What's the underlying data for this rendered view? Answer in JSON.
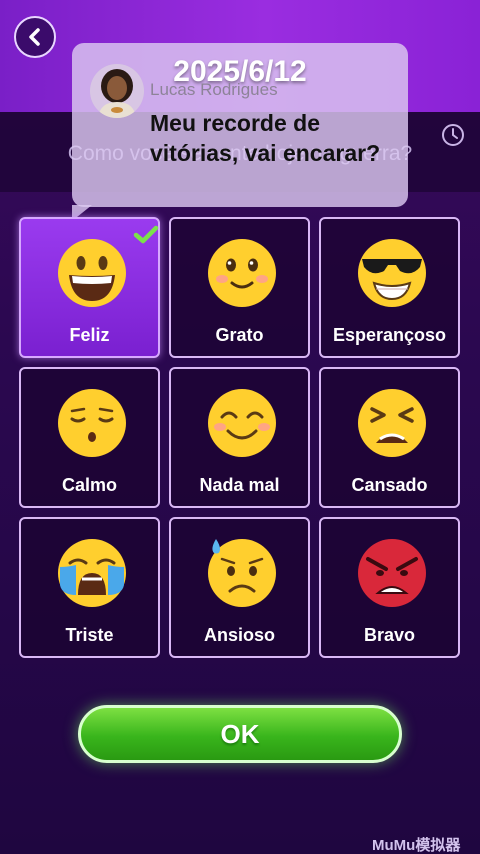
{
  "header": {
    "date": "2025/6/12",
    "question": "Como você se sente hoje na guerra?"
  },
  "chat_bubble": {
    "username": "Lucas Rodrigues",
    "message": "Meu recorde de vitórias, vai encarar?"
  },
  "moods": [
    {
      "label": "Feliz",
      "icon": "grinning-face-icon",
      "selected": true
    },
    {
      "label": "Grato",
      "icon": "smiling-face-icon",
      "selected": false
    },
    {
      "label": "Esperançoso",
      "icon": "sunglasses-face-icon",
      "selected": false
    },
    {
      "label": "Calmo",
      "icon": "relieved-face-icon",
      "selected": false
    },
    {
      "label": "Nada mal",
      "icon": "blushing-face-icon",
      "selected": false
    },
    {
      "label": "Cansado",
      "icon": "tired-face-icon",
      "selected": false
    },
    {
      "label": "Triste",
      "icon": "crying-face-icon",
      "selected": false
    },
    {
      "label": "Ansioso",
      "icon": "anxious-sweat-face-icon",
      "selected": false
    },
    {
      "label": "Bravo",
      "icon": "angry-face-icon",
      "selected": false
    }
  ],
  "actions": {
    "ok_label": "OK"
  },
  "watermark": "MuMu模拟器",
  "colors": {
    "accent_purple": "#9a2de0",
    "ok_green": "#39b51c",
    "selected_card": "#8a2ee0"
  }
}
